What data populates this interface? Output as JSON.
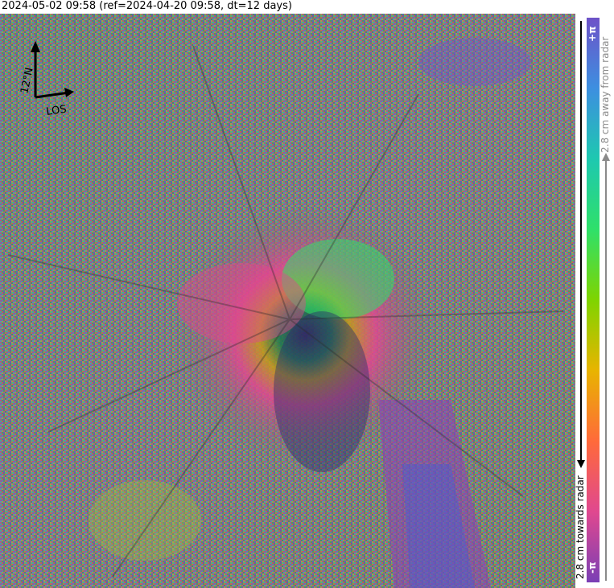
{
  "header": {
    "title": "2024-05-02 09:58 (ref=2024-04-20 09:58, dt=12 days)"
  },
  "compass": {
    "north_label": "12°N",
    "los_label": "LOS"
  },
  "colorbar": {
    "top_label": "+π",
    "bottom_label": "-π",
    "away_label": "2.8 cm away from radar",
    "towards_label": "2.8 cm towards radar",
    "colors": [
      "#7a3fb5",
      "#e0488f",
      "#ff6a3a",
      "#e8b400",
      "#7fd400",
      "#2fe06a",
      "#1ec8b0",
      "#3d8fe0",
      "#6e52c8"
    ]
  }
}
